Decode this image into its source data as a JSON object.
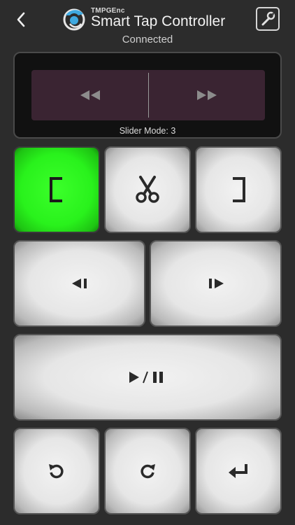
{
  "header": {
    "brand": "TMPGEnc",
    "title": "Smart Tap Controller",
    "status": "Connected",
    "back_icon": "chevron-left-icon",
    "settings_icon": "wrench-icon"
  },
  "slider": {
    "mode_text": "Slider Mode: 3",
    "left_icon": "rewind-icon",
    "right_icon": "fast-forward-icon"
  },
  "buttons": [
    {
      "name": "mark-in",
      "icon": "bracket-left-icon",
      "active": true
    },
    {
      "name": "cut",
      "icon": "scissors-icon",
      "active": false
    },
    {
      "name": "mark-out",
      "icon": "bracket-right-icon",
      "active": false
    },
    {
      "name": "previous-frame",
      "icon": "step-back-icon",
      "active": false
    },
    {
      "name": "next-frame",
      "icon": "step-forward-icon",
      "active": false
    },
    {
      "name": "play-pause",
      "icon": "play-pause-icon",
      "active": false
    },
    {
      "name": "undo",
      "icon": "undo-icon",
      "active": false
    },
    {
      "name": "redo",
      "icon": "redo-icon",
      "active": false
    },
    {
      "name": "enter",
      "icon": "enter-icon",
      "active": false
    }
  ],
  "colors": {
    "background": "#2c2c2c",
    "active_green": "#2cf01e",
    "slider_track": "#3a2432"
  }
}
